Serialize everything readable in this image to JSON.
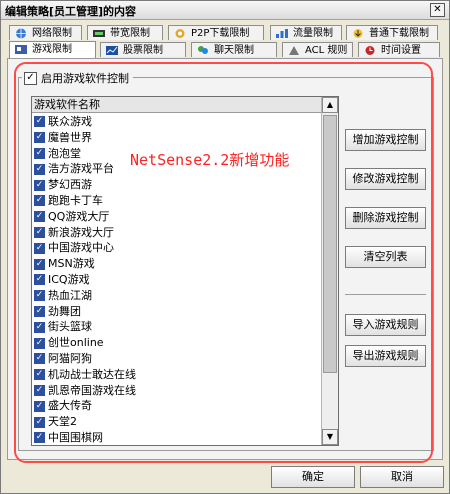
{
  "window": {
    "title": "编辑策略[员工管理]的内容"
  },
  "tabs_row1": [
    {
      "label": "网络限制",
      "icon": "globe-icon"
    },
    {
      "label": "带宽限制",
      "icon": "bandwidth-icon"
    },
    {
      "label": "P2P下载限制",
      "icon": "p2p-icon"
    },
    {
      "label": "流量限制",
      "icon": "traffic-icon"
    },
    {
      "label": "普通下载限制",
      "icon": "download-icon"
    }
  ],
  "tabs_row2": [
    {
      "label": "游戏限制",
      "icon": "game-icon",
      "active": true
    },
    {
      "label": "股票限制",
      "icon": "stock-icon"
    },
    {
      "label": "聊天限制",
      "icon": "chat-icon"
    },
    {
      "label": "ACL 规则",
      "icon": "acl-icon"
    },
    {
      "label": "时间设置",
      "icon": "clock-icon"
    }
  ],
  "enable_label": "启用游戏软件控制",
  "list": {
    "header": "游戏软件名称",
    "items": [
      "联众游戏",
      "魔兽世界",
      "泡泡堂",
      "浩方游戏平台",
      "梦幻西游",
      "跑跑卡丁车",
      "QQ游戏大厅",
      "新浪游戏大厅",
      "中国游戏中心",
      "MSN游戏",
      "ICQ游戏",
      "热血江湖",
      "劲舞团",
      "街头篮球",
      "创世online",
      "阿猫阿狗",
      "机动战士敢达在线",
      "凯恩帝国游戏在线",
      "盛大传奇",
      "天堂2",
      "中国围棋网"
    ]
  },
  "annotation": "NetSense2.2新增功能",
  "buttons": {
    "add": "增加游戏控制",
    "modify": "修改游戏控制",
    "delete": "删除游戏控制",
    "clear": "清空列表",
    "import": "导入游戏规则",
    "export": "导出游戏规则"
  },
  "footer": {
    "ok": "确定",
    "cancel": "取消"
  },
  "colors": {
    "annotation_red": "#ff2222",
    "checkbox_blue": "#2c4f9e"
  }
}
